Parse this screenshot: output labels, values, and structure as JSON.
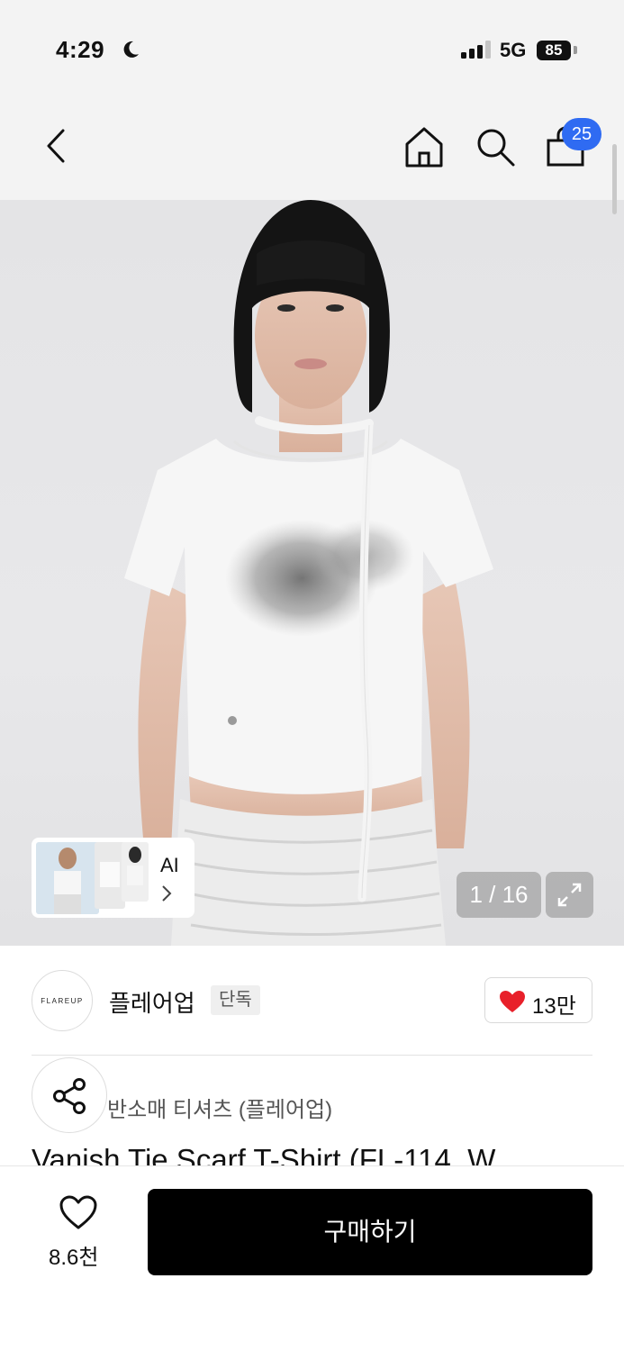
{
  "status_bar": {
    "time": "4:29",
    "network": "5G",
    "battery": "85",
    "icons": [
      "moon-icon",
      "signal-icon",
      "battery-icon"
    ]
  },
  "nav": {
    "icons": [
      "back-icon",
      "home-icon",
      "search-icon",
      "cart-icon"
    ],
    "cart_count": "25"
  },
  "gallery": {
    "ai_label": "AI",
    "counter": "1 / 16",
    "icons": [
      "chevron-right-icon",
      "expand-icon"
    ]
  },
  "brand": {
    "logo_text": "FLAREUP",
    "name": "플레어업",
    "badge": "단독",
    "likes": "13만"
  },
  "product": {
    "category": "반소매 티셔츠 (플레어업)",
    "title": "Vanish Tie Scarf T-Shirt (FL-114_W"
  },
  "bottom_bar": {
    "wish_count": "8.6천",
    "buy_label": "구매하기"
  },
  "colors": {
    "accent_badge": "#2f6bf2",
    "heart": "#e8202a",
    "buy_button": "#000000"
  }
}
